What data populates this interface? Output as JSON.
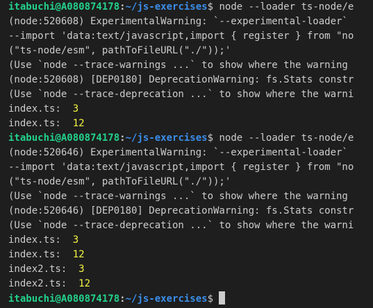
{
  "prompt": {
    "userhost": "itabuchi@A080874178",
    "colon": ":",
    "path": "~/js-exercises",
    "sigil": "$ "
  },
  "colors": {
    "background": "#1e1e1e",
    "text": "#cccccc",
    "userhost": "#23d18b",
    "path": "#3b8eea",
    "number": "#f5f543"
  },
  "blocks": [
    {
      "command": "node --loader ts-node/e",
      "output": [
        "(node:520608) ExperimentalWarning: `--experimental-loader`",
        "--import 'data:text/javascript,import { register } from \"no",
        "(\"ts-node/esm\", pathToFileURL(\"./\"));'",
        "(Use `node --trace-warnings ...` to show where the warning",
        "(node:520608) [DEP0180] DeprecationWarning: fs.Stats constr",
        "(Use `node --trace-deprecation ...` to show where the warni"
      ],
      "results": [
        {
          "label": "index.ts:  ",
          "value": "3"
        },
        {
          "label": "index.ts:  ",
          "value": "12"
        }
      ]
    },
    {
      "command": "node --loader ts-node/e",
      "output": [
        "(node:520646) ExperimentalWarning: `--experimental-loader`",
        "--import 'data:text/javascript,import { register } from \"no",
        "(\"ts-node/esm\", pathToFileURL(\"./\"));'",
        "(Use `node --trace-warnings ...` to show where the warning",
        "(node:520646) [DEP0180] DeprecationWarning: fs.Stats constr",
        "(Use `node --trace-deprecation ...` to show where the warni"
      ],
      "results": [
        {
          "label": "index.ts:  ",
          "value": "3"
        },
        {
          "label": "index.ts:  ",
          "value": "12"
        },
        {
          "label": "index2.ts:  ",
          "value": "3"
        },
        {
          "label": "index2.ts:  ",
          "value": "12"
        }
      ]
    }
  ],
  "final_prompt": {
    "command": ""
  }
}
